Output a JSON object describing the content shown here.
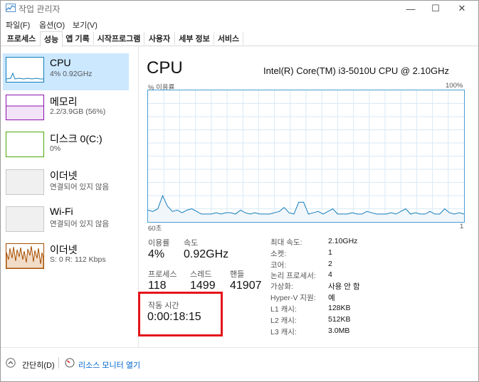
{
  "window": {
    "title": "작업 관리자",
    "controls": {
      "minimize": "—",
      "maximize": "☐",
      "close": "✕"
    }
  },
  "menu": [
    "파일(F)",
    "옵션(O)",
    "보기(V)"
  ],
  "tabs": [
    {
      "label": "프로세스",
      "active": false
    },
    {
      "label": "성능",
      "active": true
    },
    {
      "label": "앱 기록",
      "active": false
    },
    {
      "label": "시작프로그램",
      "active": false
    },
    {
      "label": "사용자",
      "active": false
    },
    {
      "label": "세부 정보",
      "active": false
    },
    {
      "label": "서비스",
      "active": false
    }
  ],
  "sidebar": {
    "items": [
      {
        "title": "CPU",
        "sub": "4% 0.92GHz",
        "color": "#117dbb",
        "selected": true
      },
      {
        "title": "메모리",
        "sub": "2.2/3.9GB (56%)",
        "color": "#8b12ae",
        "selected": false
      },
      {
        "title": "디스크 0(C:)",
        "sub": "0%",
        "color": "#4da60c",
        "selected": false
      },
      {
        "title": "이더넷",
        "sub": "연결되어 있지 않음",
        "color": "#a0a0a0",
        "selected": false
      },
      {
        "title": "Wi-Fi",
        "sub": "연결되어 있지 않음",
        "color": "#a0a0a0",
        "selected": false
      },
      {
        "title": "이더넷",
        "sub": "S: 0  R: 112 Kbps",
        "color": "#a74f01",
        "selected": false
      }
    ]
  },
  "main": {
    "title": "CPU",
    "model": "Intel(R) Core(TM) i3-5010U CPU @ 2.10GHz",
    "graph": {
      "usage_label": "% 이용률",
      "max_label": "100%",
      "time_left": "60초",
      "time_right": "1",
      "usage_series": [
        9,
        8,
        10,
        20,
        12,
        8,
        9,
        7,
        9,
        10,
        8,
        6,
        6,
        6,
        7,
        6,
        7,
        7,
        6,
        9,
        7,
        6,
        7,
        6,
        6,
        6,
        7,
        8,
        11,
        7,
        6,
        15,
        15,
        6,
        7,
        8,
        6,
        8,
        10,
        6,
        6,
        6,
        7,
        6,
        6,
        8,
        7,
        6,
        6,
        6,
        7,
        6,
        8,
        10,
        6,
        7,
        6,
        6,
        8,
        6,
        6,
        10,
        7,
        6,
        7,
        6
      ]
    },
    "stats": {
      "usage_label": "이용률",
      "usage_value": "4%",
      "speed_label": "속도",
      "speed_value": "0.92GHz",
      "processes_label": "프로세스",
      "processes_value": "118",
      "threads_label": "스레드",
      "threads_value": "1499",
      "handles_label": "핸들",
      "handles_value": "41907",
      "uptime_label": "작동 시간",
      "uptime_value": "0:00:18:15"
    },
    "info": [
      {
        "label": "최대 속도:",
        "value": "2.10GHz"
      },
      {
        "label": "소켓:",
        "value": "1"
      },
      {
        "label": "코어:",
        "value": "2"
      },
      {
        "label": "논리 프로세서:",
        "value": "4"
      },
      {
        "label": "가상화:",
        "value": "사용 안 함"
      },
      {
        "label": "Hyper-V 지원:",
        "value": "예"
      },
      {
        "label": "L1 캐시:",
        "value": "128KB"
      },
      {
        "label": "L2 캐시:",
        "value": "512KB"
      },
      {
        "label": "L3 캐시:",
        "value": "3.0MB"
      }
    ],
    "highlight_color": "#e3141b"
  },
  "footer": {
    "fewer_details": "간단히(D)",
    "resource_monitor": "리소스 모니터 열기"
  }
}
